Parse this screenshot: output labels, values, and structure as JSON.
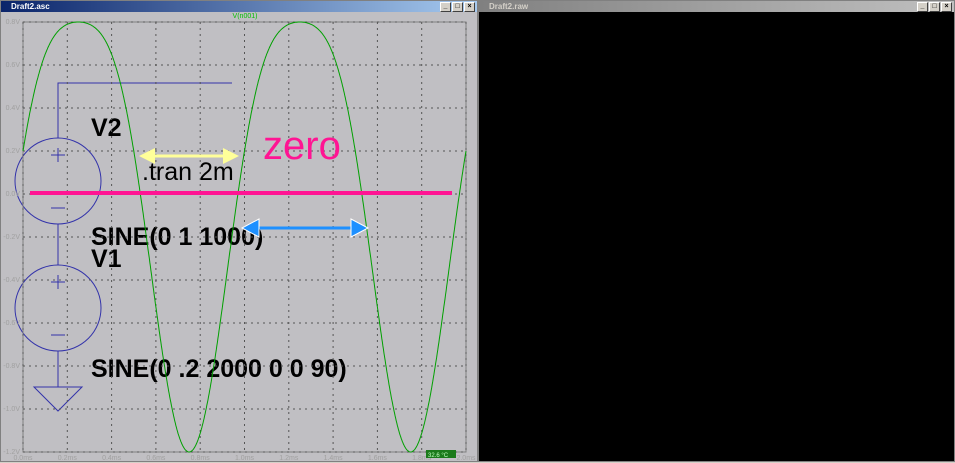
{
  "schematic": {
    "title": "Draft2.asc",
    "v2_name": "V2",
    "v2_value": "SINE(0 1 1000)",
    "v1_name": "V1",
    "v1_value": "SINE(0 .2 2000 0 0 90)",
    "directive": ".tran 2m"
  },
  "waveform": {
    "title": "Draft2.raw",
    "trace_label": "V(n001)",
    "annotation": "zero",
    "status": "32.6 °C",
    "colors": {
      "trace": "#00a000",
      "zero_line": "#ff1493",
      "yellow_arrow": "#ffff99",
      "blue_arrow": "#1e90ff"
    }
  },
  "chart_data": {
    "type": "line",
    "title": "V(n001)",
    "xlabel": "",
    "ylabel": "",
    "xlim": [
      0,
      2
    ],
    "ylim": [
      -1.2,
      0.8
    ],
    "x_ticks": [
      "0.0ms",
      "0.2ms",
      "0.4ms",
      "0.6ms",
      "0.8ms",
      "1.0ms",
      "1.2ms",
      "1.4ms",
      "1.6ms",
      "1.8ms",
      "2.0ms"
    ],
    "y_ticks": [
      "0.8V",
      "0.6V",
      "0.4V",
      "0.2V",
      "0.0V",
      "-0.2V",
      "-0.4V",
      "-0.6V",
      "-0.8V",
      "-1.0V",
      "-1.2V"
    ],
    "series": [
      {
        "name": "V(n001)",
        "formula": "sin(2*pi*1000*t)+0.2*sin(2*pi*2000*t+90deg)"
      }
    ]
  }
}
